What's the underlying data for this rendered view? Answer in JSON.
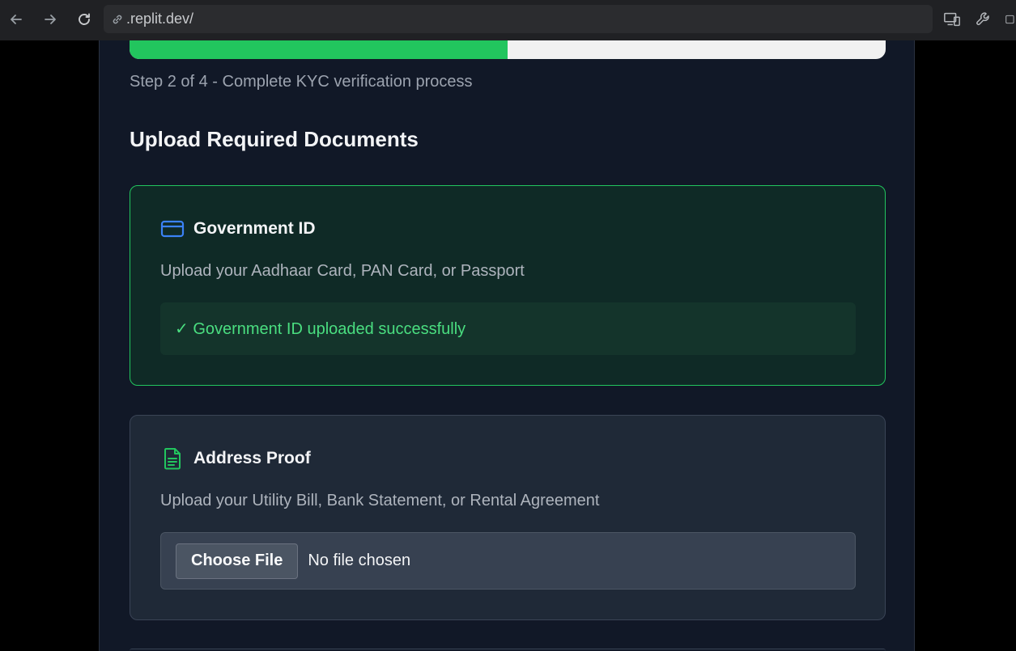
{
  "browser": {
    "url": ".replit.dev/"
  },
  "progress": {
    "fraction": 0.5,
    "step_text": "Step 2 of 4 - Complete KYC verification process"
  },
  "section_title": "Upload Required Documents",
  "government_id": {
    "title": "Government ID",
    "description": "Upload your Aadhaar Card, PAN Card, or Passport",
    "status": "✓ Government ID uploaded successfully"
  },
  "address_proof": {
    "title": "Address Proof",
    "description": "Upload your Utility Bill, Bank Statement, or Rental Agreement",
    "choose_file_label": "Choose File",
    "file_status": "No file chosen"
  },
  "colors": {
    "accent_green": "#22c55e",
    "id_icon_blue": "#3b82f6",
    "panel_bg": "#111827"
  },
  "icons": {
    "back": "arrow-left-icon",
    "forward": "arrow-right-icon",
    "reload": "reload-icon",
    "link": "link-icon",
    "devices": "devices-icon",
    "tools": "wrench-icon",
    "new_tab": "external-link-icon",
    "gov_id": "credit-card-icon",
    "address": "document-icon"
  }
}
